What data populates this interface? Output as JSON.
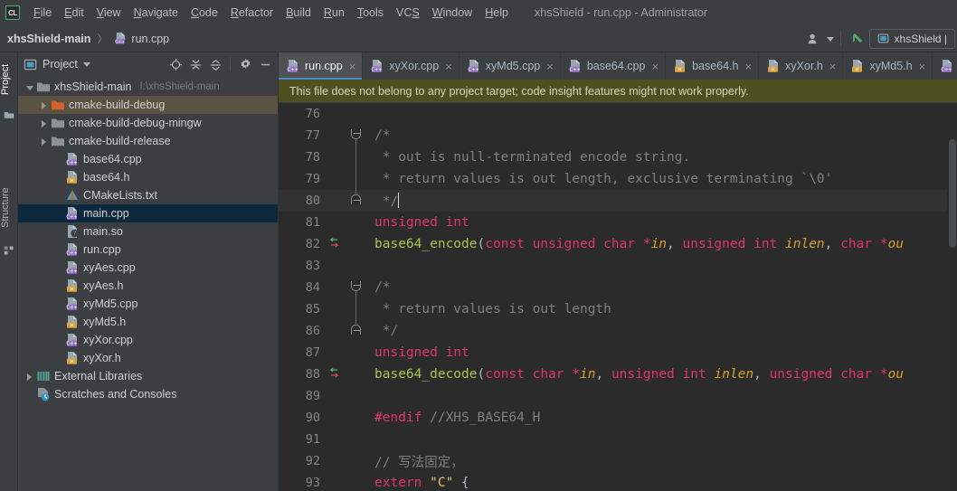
{
  "window": {
    "app_badge": "CL",
    "title": "xhsShield - run.cpp - Administrator"
  },
  "menubar": {
    "items": [
      {
        "label": "File",
        "mnemonic": "F"
      },
      {
        "label": "Edit",
        "mnemonic": "E"
      },
      {
        "label": "View",
        "mnemonic": "V"
      },
      {
        "label": "Navigate",
        "mnemonic": "N"
      },
      {
        "label": "Code",
        "mnemonic": "C"
      },
      {
        "label": "Refactor",
        "mnemonic": "R"
      },
      {
        "label": "Build",
        "mnemonic": "B"
      },
      {
        "label": "Run",
        "mnemonic": "R"
      },
      {
        "label": "Tools",
        "mnemonic": "T"
      },
      {
        "label": "VCS",
        "mnemonic": "S"
      },
      {
        "label": "Window",
        "mnemonic": "W"
      },
      {
        "label": "Help",
        "mnemonic": "H"
      }
    ]
  },
  "navbar": {
    "breadcrumb_root": "xhsShield-main",
    "breadcrumb_separator": "〉",
    "breadcrumb_file": "run.cpp",
    "user_icon": "user-icon",
    "dropdown_icon": "chevron-down-icon",
    "updates_icon": "green-arrow-icon",
    "run_config_icon": "window-icon",
    "run_config_label": "xhsShield |"
  },
  "toolstrip": {
    "tabs": [
      {
        "label": "Project",
        "selected": true,
        "icon": "project-icon"
      },
      {
        "label": "Structure",
        "selected": false,
        "icon": "structure-icon"
      }
    ]
  },
  "project_panel": {
    "title": "Project",
    "title_dropdown_icon": "chevron-down-icon",
    "panel_icon": "project-window-icon",
    "actions": [
      {
        "name": "select-opened-file-icon",
        "glyph": "target-icon"
      },
      {
        "name": "expand-all-icon",
        "glyph": "expand-icon"
      },
      {
        "name": "collapse-all-icon",
        "glyph": "collapse-icon"
      },
      {
        "name": "settings-icon",
        "glyph": "gear-icon"
      },
      {
        "name": "hide-panel-icon",
        "glyph": "minus-icon"
      }
    ],
    "tree": [
      {
        "label": "xhsShield-main",
        "path": "I:\\xhsShield-main",
        "indent": 0,
        "arrow": "down",
        "icon": "folder-root",
        "state": "normal"
      },
      {
        "label": "cmake-build-debug",
        "path": "",
        "indent": 1,
        "arrow": "right",
        "icon": "folder-excluded",
        "state": "hover"
      },
      {
        "label": "cmake-build-debug-mingw",
        "path": "",
        "indent": 1,
        "arrow": "right",
        "icon": "folder",
        "state": "normal"
      },
      {
        "label": "cmake-build-release",
        "path": "",
        "indent": 1,
        "arrow": "right",
        "icon": "folder",
        "state": "normal"
      },
      {
        "label": "base64.cpp",
        "path": "",
        "indent": 2,
        "arrow": "none",
        "icon": "cpp-file",
        "state": "normal"
      },
      {
        "label": "base64.h",
        "path": "",
        "indent": 2,
        "arrow": "none",
        "icon": "h-file",
        "state": "normal"
      },
      {
        "label": "CMakeLists.txt",
        "path": "",
        "indent": 2,
        "arrow": "none",
        "icon": "cmake-file",
        "state": "normal"
      },
      {
        "label": "main.cpp",
        "path": "",
        "indent": 2,
        "arrow": "none",
        "icon": "cpp-file",
        "state": "selected"
      },
      {
        "label": "main.so",
        "path": "",
        "indent": 2,
        "arrow": "none",
        "icon": "unknown-file",
        "state": "normal"
      },
      {
        "label": "run.cpp",
        "path": "",
        "indent": 2,
        "arrow": "none",
        "icon": "cpp-file",
        "state": "normal"
      },
      {
        "label": "xyAes.cpp",
        "path": "",
        "indent": 2,
        "arrow": "none",
        "icon": "cpp-file",
        "state": "normal"
      },
      {
        "label": "xyAes.h",
        "path": "",
        "indent": 2,
        "arrow": "none",
        "icon": "h-file",
        "state": "normal"
      },
      {
        "label": "xyMd5.cpp",
        "path": "",
        "indent": 2,
        "arrow": "none",
        "icon": "cpp-file",
        "state": "normal"
      },
      {
        "label": "xyMd5.h",
        "path": "",
        "indent": 2,
        "arrow": "none",
        "icon": "h-file",
        "state": "normal"
      },
      {
        "label": "xyXor.cpp",
        "path": "",
        "indent": 2,
        "arrow": "none",
        "icon": "cpp-file",
        "state": "normal"
      },
      {
        "label": "xyXor.h",
        "path": "",
        "indent": 2,
        "arrow": "none",
        "icon": "h-file",
        "state": "normal"
      },
      {
        "label": "External Libraries",
        "path": "",
        "indent": 0,
        "arrow": "right",
        "icon": "libraries-icon",
        "state": "normal"
      },
      {
        "label": "Scratches and Consoles",
        "path": "",
        "indent": 0,
        "arrow": "none",
        "icon": "scratches-icon",
        "state": "normal"
      }
    ]
  },
  "editor": {
    "tabs": [
      {
        "label": "run.cpp",
        "icon": "cpp-file",
        "active": true
      },
      {
        "label": "xyXor.cpp",
        "icon": "cpp-file",
        "active": false
      },
      {
        "label": "xyMd5.cpp",
        "icon": "cpp-file",
        "active": false
      },
      {
        "label": "base64.cpp",
        "icon": "cpp-file",
        "active": false
      },
      {
        "label": "base64.h",
        "icon": "h-file",
        "active": false
      },
      {
        "label": "xyXor.h",
        "icon": "h-file",
        "active": false
      },
      {
        "label": "xyMd5.h",
        "icon": "h-file",
        "active": false
      },
      {
        "label": "",
        "icon": "cpp-file",
        "active": false
      }
    ],
    "close_glyph": "×",
    "banner": "This file does not belong to any project target; code insight features might not work properly.",
    "lines": [
      {
        "num": "76",
        "fold": "none",
        "mark": "none",
        "cursor": false,
        "tokens": []
      },
      {
        "num": "77",
        "fold": "start",
        "mark": "none",
        "cursor": false,
        "tokens": [
          {
            "t": "/*",
            "c": "cmt"
          }
        ]
      },
      {
        "num": "78",
        "fold": "line",
        "mark": "none",
        "cursor": false,
        "tokens": [
          {
            "t": " * out is null-terminated encode string.",
            "c": "cmt"
          }
        ]
      },
      {
        "num": "79",
        "fold": "line",
        "mark": "none",
        "cursor": false,
        "tokens": [
          {
            "t": " * return values is out length, exclusive terminating `\\0'",
            "c": "cmt"
          }
        ]
      },
      {
        "num": "80",
        "fold": "end",
        "mark": "none",
        "cursor": true,
        "tokens": [
          {
            "t": " */",
            "c": "cmt"
          }
        ]
      },
      {
        "num": "81",
        "fold": "none",
        "mark": "none",
        "cursor": false,
        "tokens": [
          {
            "t": "unsigned int",
            "c": "kw2"
          }
        ]
      },
      {
        "num": "82",
        "fold": "none",
        "mark": "override",
        "cursor": false,
        "tokens": [
          {
            "t": "base64_encode",
            "c": "fn"
          },
          {
            "t": "(",
            "c": "punc"
          },
          {
            "t": "const unsigned char ",
            "c": "kw2"
          },
          {
            "t": "*",
            "c": "op"
          },
          {
            "t": "in",
            "c": "par"
          },
          {
            "t": ", ",
            "c": "punc"
          },
          {
            "t": "unsigned int ",
            "c": "kw2"
          },
          {
            "t": "inlen",
            "c": "par"
          },
          {
            "t": ", ",
            "c": "punc"
          },
          {
            "t": "char ",
            "c": "kw2"
          },
          {
            "t": "*",
            "c": "op"
          },
          {
            "t": "ou",
            "c": "par"
          }
        ]
      },
      {
        "num": "83",
        "fold": "none",
        "mark": "none",
        "cursor": false,
        "tokens": []
      },
      {
        "num": "84",
        "fold": "start",
        "mark": "none",
        "cursor": false,
        "tokens": [
          {
            "t": "/*",
            "c": "cmt"
          }
        ]
      },
      {
        "num": "85",
        "fold": "line",
        "mark": "none",
        "cursor": false,
        "tokens": [
          {
            "t": " * return values is out length",
            "c": "cmt"
          }
        ]
      },
      {
        "num": "86",
        "fold": "end",
        "mark": "none",
        "cursor": false,
        "tokens": [
          {
            "t": " */",
            "c": "cmt"
          }
        ]
      },
      {
        "num": "87",
        "fold": "none",
        "mark": "none",
        "cursor": false,
        "tokens": [
          {
            "t": "unsigned int",
            "c": "kw2"
          }
        ]
      },
      {
        "num": "88",
        "fold": "none",
        "mark": "override",
        "cursor": false,
        "tokens": [
          {
            "t": "base64_decode",
            "c": "fn"
          },
          {
            "t": "(",
            "c": "punc"
          },
          {
            "t": "const char ",
            "c": "kw2"
          },
          {
            "t": "*",
            "c": "op"
          },
          {
            "t": "in",
            "c": "par"
          },
          {
            "t": ", ",
            "c": "punc"
          },
          {
            "t": "unsigned int ",
            "c": "kw2"
          },
          {
            "t": "inlen",
            "c": "par"
          },
          {
            "t": ", ",
            "c": "punc"
          },
          {
            "t": "unsigned char ",
            "c": "kw2"
          },
          {
            "t": "*",
            "c": "op"
          },
          {
            "t": "ou",
            "c": "par"
          }
        ]
      },
      {
        "num": "89",
        "fold": "none",
        "mark": "none",
        "cursor": false,
        "tokens": []
      },
      {
        "num": "90",
        "fold": "none",
        "mark": "none",
        "cursor": false,
        "tokens": [
          {
            "t": "#endif ",
            "c": "pp"
          },
          {
            "t": "//XHS_BASE64_H",
            "c": "cmt"
          }
        ]
      },
      {
        "num": "91",
        "fold": "none",
        "mark": "none",
        "cursor": false,
        "tokens": []
      },
      {
        "num": "92",
        "fold": "none",
        "mark": "none",
        "cursor": false,
        "tokens": [
          {
            "t": "// 写法固定，",
            "c": "cmt"
          }
        ]
      },
      {
        "num": "93",
        "fold": "none",
        "mark": "none",
        "cursor": false,
        "tokens": [
          {
            "t": "extern ",
            "c": "kw2"
          },
          {
            "t": "\"C\"",
            "c": "str"
          },
          {
            "t": " {",
            "c": "punc"
          }
        ]
      }
    ]
  },
  "colors": {
    "chrome": "#3c3f41",
    "editor_bg": "#2b2b2b",
    "banner_bg": "#4e5021",
    "accent": "#4a88c7",
    "selection": "#0d293e",
    "hover": "#5a5242",
    "keyword": "#e2356d",
    "function": "#a9c44b",
    "comment": "#808080",
    "parameter": "#d9a122",
    "string": "#e8c76e"
  }
}
